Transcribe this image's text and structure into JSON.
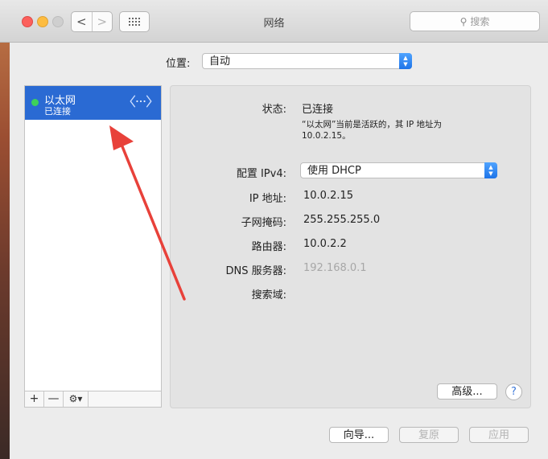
{
  "window": {
    "title": "网络",
    "search_placeholder": "搜索",
    "nav_back": "<",
    "nav_forward": ">"
  },
  "location": {
    "label": "位置:",
    "value": "自动"
  },
  "services": [
    {
      "name": "以太网",
      "status": "已连接",
      "icon": "ethernet-arrows-icon",
      "status_color": "#3dd15b"
    }
  ],
  "list_toolbar": {
    "add": "+",
    "remove": "—",
    "gear": "⚙▾"
  },
  "details": {
    "status_label": "状态:",
    "status_value": "已连接",
    "status_desc": "“以太网”当前是活跃的，其 IP 地址为 10.0.2.15。",
    "config_label": "配置 IPv4:",
    "config_value": "使用 DHCP",
    "ip_label": "IP 地址:",
    "ip_value": "10.0.2.15",
    "subnet_label": "子网掩码:",
    "subnet_value": "255.255.255.0",
    "router_label": "路由器:",
    "router_value": "10.0.2.2",
    "dns_label": "DNS 服务器:",
    "dns_value": "192.168.0.1",
    "search_domain_label": "搜索域:",
    "advanced_button": "高级...",
    "help_button": "?"
  },
  "footer": {
    "assist_button": "向导...",
    "revert_button": "复原",
    "apply_button": "应用"
  },
  "colors": {
    "selection": "#2a6ad3",
    "status_green": "#3dd15b",
    "annotation_arrow": "#e8413a"
  }
}
